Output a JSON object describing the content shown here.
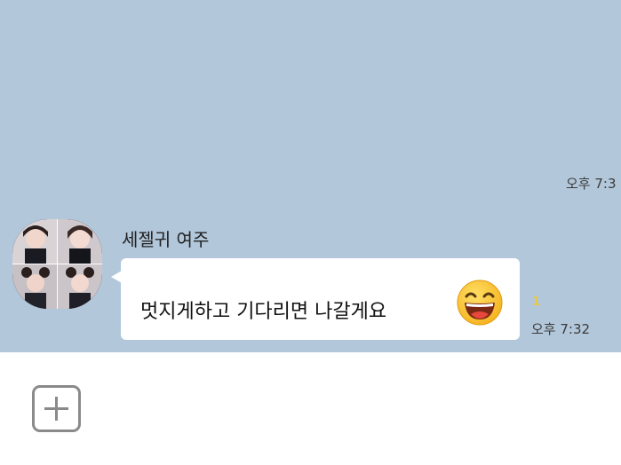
{
  "chat": {
    "previous_time": "오후 7:3",
    "sender_name": "세젤귀 여주",
    "message_text": "멋지게하고 기다리면 나갈게요",
    "unread_count": "1",
    "message_time": "오후 7:32",
    "emoji_icon": "grinning-face-icon"
  },
  "colors": {
    "chat_background": "#b2c7da",
    "bubble": "#ffffff",
    "unread_badge": "#e8c94a"
  },
  "input_bar": {
    "attach_icon": "plus-icon"
  }
}
